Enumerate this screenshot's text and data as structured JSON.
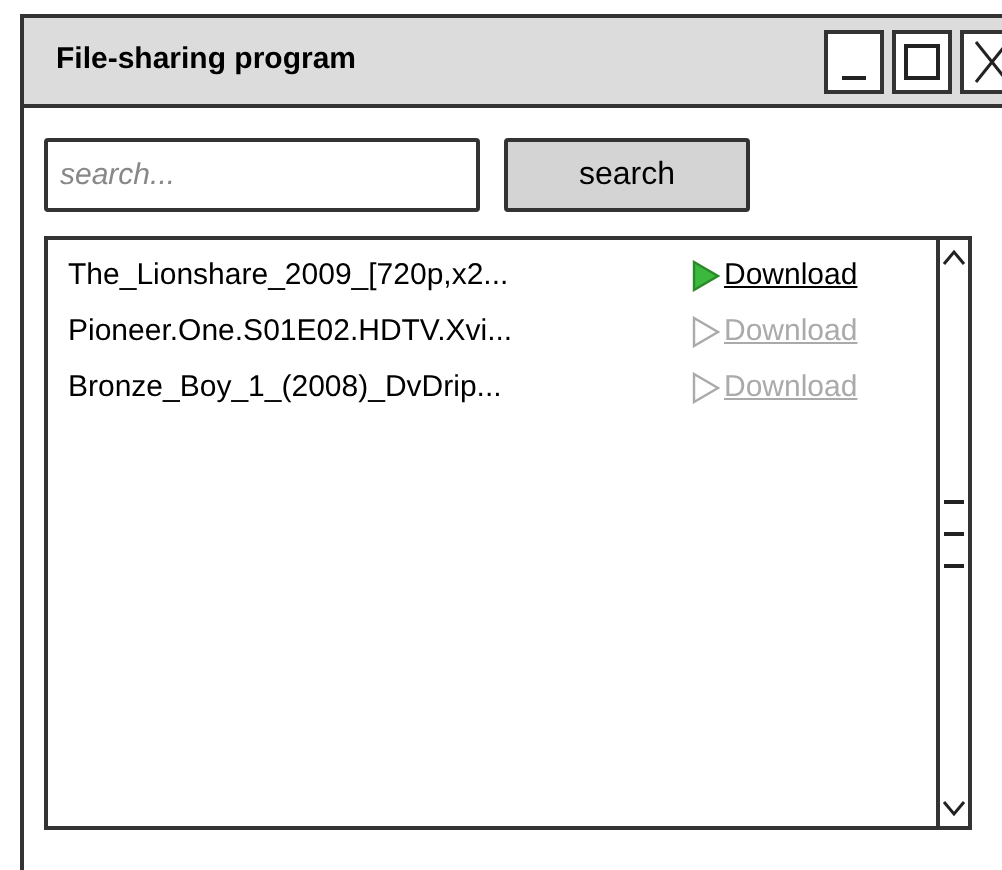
{
  "window": {
    "title": "File-sharing program"
  },
  "search": {
    "placeholder": "search...",
    "button": "search"
  },
  "results": [
    {
      "name": "The_Lionshare_2009_[720p,x2...",
      "action": "Download",
      "disabled": false
    },
    {
      "name": "Pioneer.One.S01E02.HDTV.Xvi...",
      "action": "Download",
      "disabled": true
    },
    {
      "name": "Bronze_Boy_1_(2008)_DvDrip...",
      "action": "Download",
      "disabled": true
    }
  ]
}
